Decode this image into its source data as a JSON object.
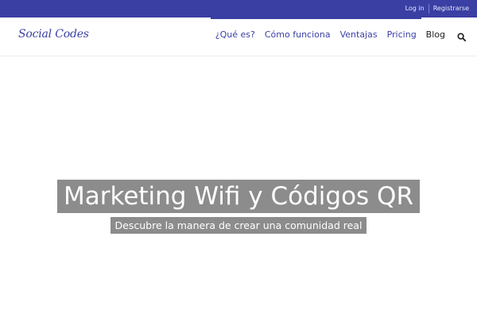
{
  "topbar": {
    "login_label": "Log in",
    "register_label": "Registrarse",
    "background_color": "#3a3fa3"
  },
  "header": {
    "logo_text": "Social Codes",
    "nav": {
      "que_es": "¿Qué es?",
      "como_funciona": "Cómo funciona",
      "ventajas": "Ventajas",
      "pricing": "Pricing",
      "blog": "Blog"
    },
    "search_icon": "search-icon",
    "accent_color": "#3a3fa3"
  },
  "hero": {
    "title": "Marketing Wifi y Códigos QR",
    "subtitle": "Descubre la manera de crear una comunidad real",
    "label_background": "#8c8c8c"
  }
}
